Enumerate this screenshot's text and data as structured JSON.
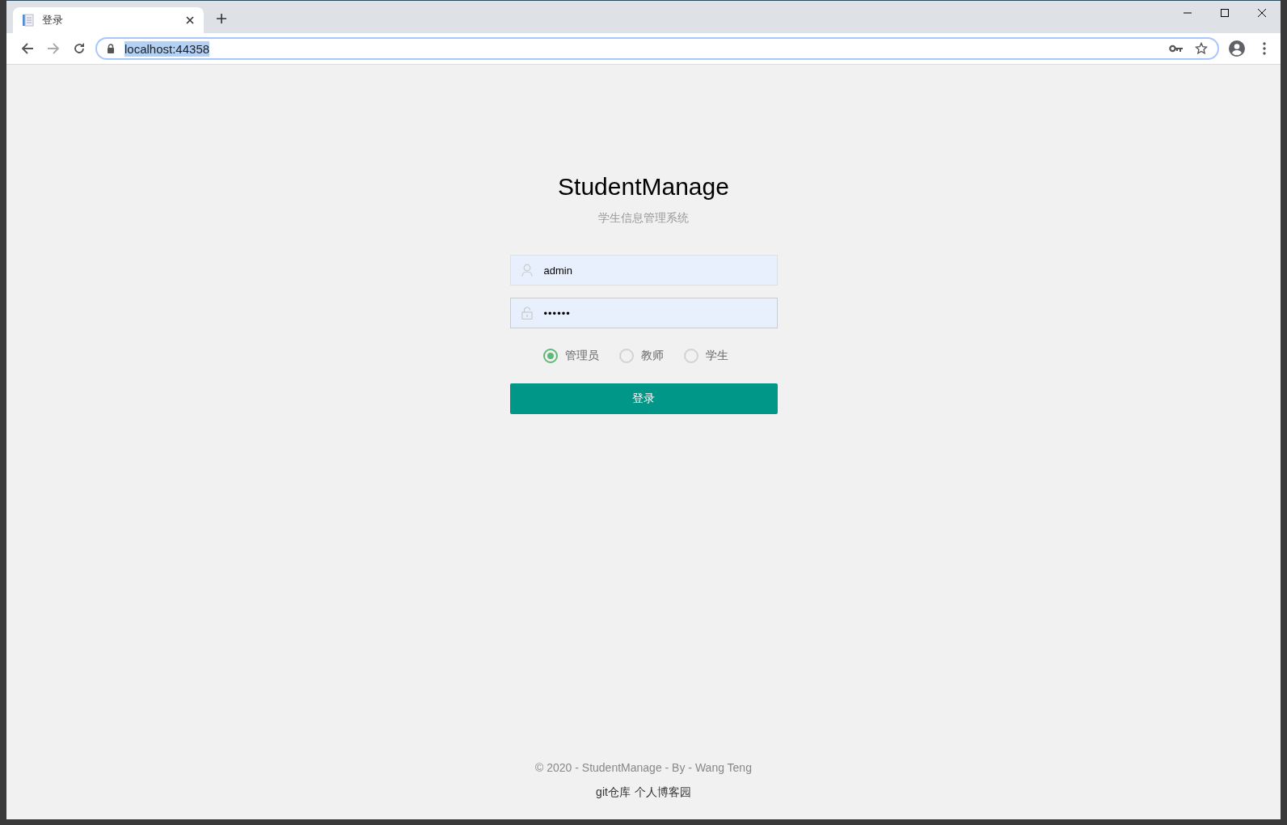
{
  "browser": {
    "tabs": [
      {
        "title": "登录",
        "selected": true
      }
    ],
    "address": "localhost:44358",
    "address_selected": true
  },
  "page": {
    "title": "StudentManage",
    "subtitle": "学生信息管理系统",
    "fields": [
      {
        "kind": "user",
        "value": "admin"
      },
      {
        "kind": "password",
        "value": "••••••"
      }
    ],
    "roles": [
      {
        "label": "管理员",
        "selected": true
      },
      {
        "label": "教师",
        "selected": false
      },
      {
        "label": "学生",
        "selected": false
      }
    ],
    "submit": "登录",
    "footer": {
      "copyright": "© 2020 - StudentManage - By - Wang Teng",
      "links": [
        "git仓库",
        "个人博客园"
      ]
    }
  }
}
